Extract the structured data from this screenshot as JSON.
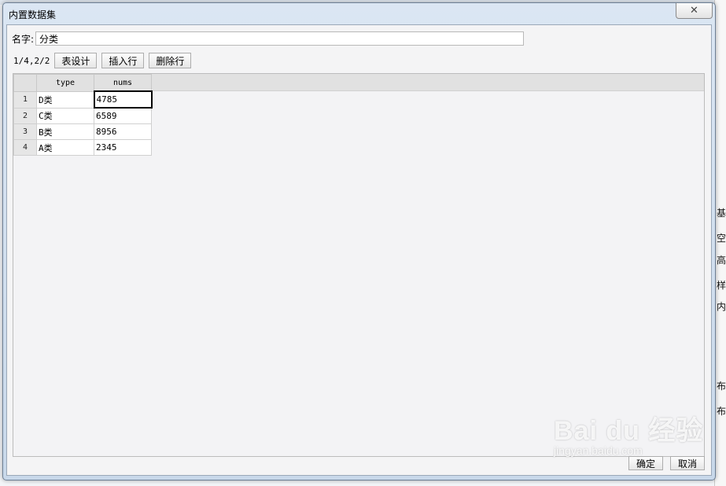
{
  "dialog": {
    "title": "内置数据集",
    "close_glyph": "✕"
  },
  "name_field": {
    "label": "名字:",
    "value": "分类"
  },
  "toolbar": {
    "page_info": "1/4,2/2",
    "table_design_label": "表设计",
    "insert_row_label": "插入行",
    "delete_row_label": "删除行"
  },
  "grid": {
    "columns": [
      "type",
      "nums"
    ],
    "rows": [
      {
        "num": "1",
        "type": "D类",
        "nums": "4785"
      },
      {
        "num": "2",
        "type": "C类",
        "nums": "6589"
      },
      {
        "num": "3",
        "type": "B类",
        "nums": "8956"
      },
      {
        "num": "4",
        "type": "A类",
        "nums": "2345"
      }
    ]
  },
  "footer": {
    "ok_label": "确定",
    "cancel_label": "取消"
  },
  "background_fragments": [
    "基",
    "空",
    "高",
    "样",
    "内",
    "布",
    "布"
  ],
  "watermark": {
    "main": "Bai du 经验",
    "sub": "jingyan.baidu.com"
  }
}
